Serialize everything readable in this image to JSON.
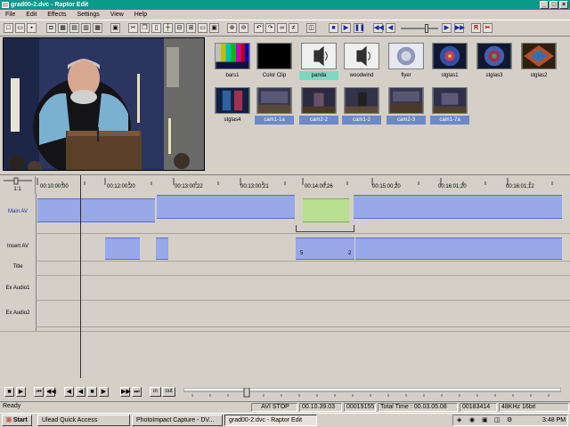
{
  "window": {
    "title": "grad00-2.dvc - Raptor Edit"
  },
  "menu": [
    "File",
    "Edit",
    "Effects",
    "Settings",
    "View",
    "Help"
  ],
  "clips": [
    {
      "label": "bars1",
      "style": "normal",
      "thumb": "bars"
    },
    {
      "label": "Color Clip",
      "style": "normal",
      "thumb": "black"
    },
    {
      "label": "panda",
      "style": "green",
      "thumb": "audio"
    },
    {
      "label": "woodwind",
      "style": "normal",
      "thumb": "audio"
    },
    {
      "label": "flyer",
      "style": "normal",
      "thumb": "seal"
    },
    {
      "label": "stglas1",
      "style": "normal",
      "thumb": "glass"
    },
    {
      "label": "stglas3",
      "style": "normal",
      "thumb": "glass"
    },
    {
      "label": "stglas2",
      "style": "normal",
      "thumb": "glass2"
    },
    {
      "label": "stglas4",
      "style": "normal",
      "thumb": "glass"
    },
    {
      "label": "cam1-1a",
      "style": "blue",
      "thumb": "hall"
    },
    {
      "label": "cam2-2",
      "style": "blue",
      "thumb": "hall"
    },
    {
      "label": "cam1-2",
      "style": "blue",
      "thumb": "hall"
    },
    {
      "label": "cam2-3",
      "style": "blue",
      "thumb": "hall"
    },
    {
      "label": "cam1-7a",
      "style": "blue",
      "thumb": "hall"
    }
  ],
  "timeline": {
    "ruler_mode": "1:1",
    "timecodes": [
      "00:10:00;00",
      "00:12:00;20",
      "00:13:00;22",
      "00:13:00;21",
      "00:14:00;26",
      "00:15:00;20",
      "00:16:01;20",
      "00:16:01;12"
    ],
    "tracks": [
      "Main AV",
      "Insert AV",
      "Title",
      "Ex Audio1",
      "Ex Audio2"
    ],
    "insert_markers": [
      "5",
      "2"
    ]
  },
  "controls": {
    "in_label": "in",
    "out_label": "out"
  },
  "status": {
    "state": "Ready",
    "mode": "AVI STOP",
    "position": "00.10.39.03",
    "frames": "00019155",
    "total": "Total Time : 00.03.05.08",
    "frames2": "00183414",
    "audio": "48KHz 16bit"
  },
  "taskbar": {
    "start": "Start",
    "tasks": [
      "Ulead Quick Access",
      "PhotoImpact Capture - DV...",
      "grad00-2.dvc - Raptor Edit"
    ],
    "clock": "3:48 PM"
  },
  "colors": {
    "title_bar": "#0a9a8a",
    "clip_blue": "#98a8e8",
    "clip_green": "#b8e090"
  }
}
